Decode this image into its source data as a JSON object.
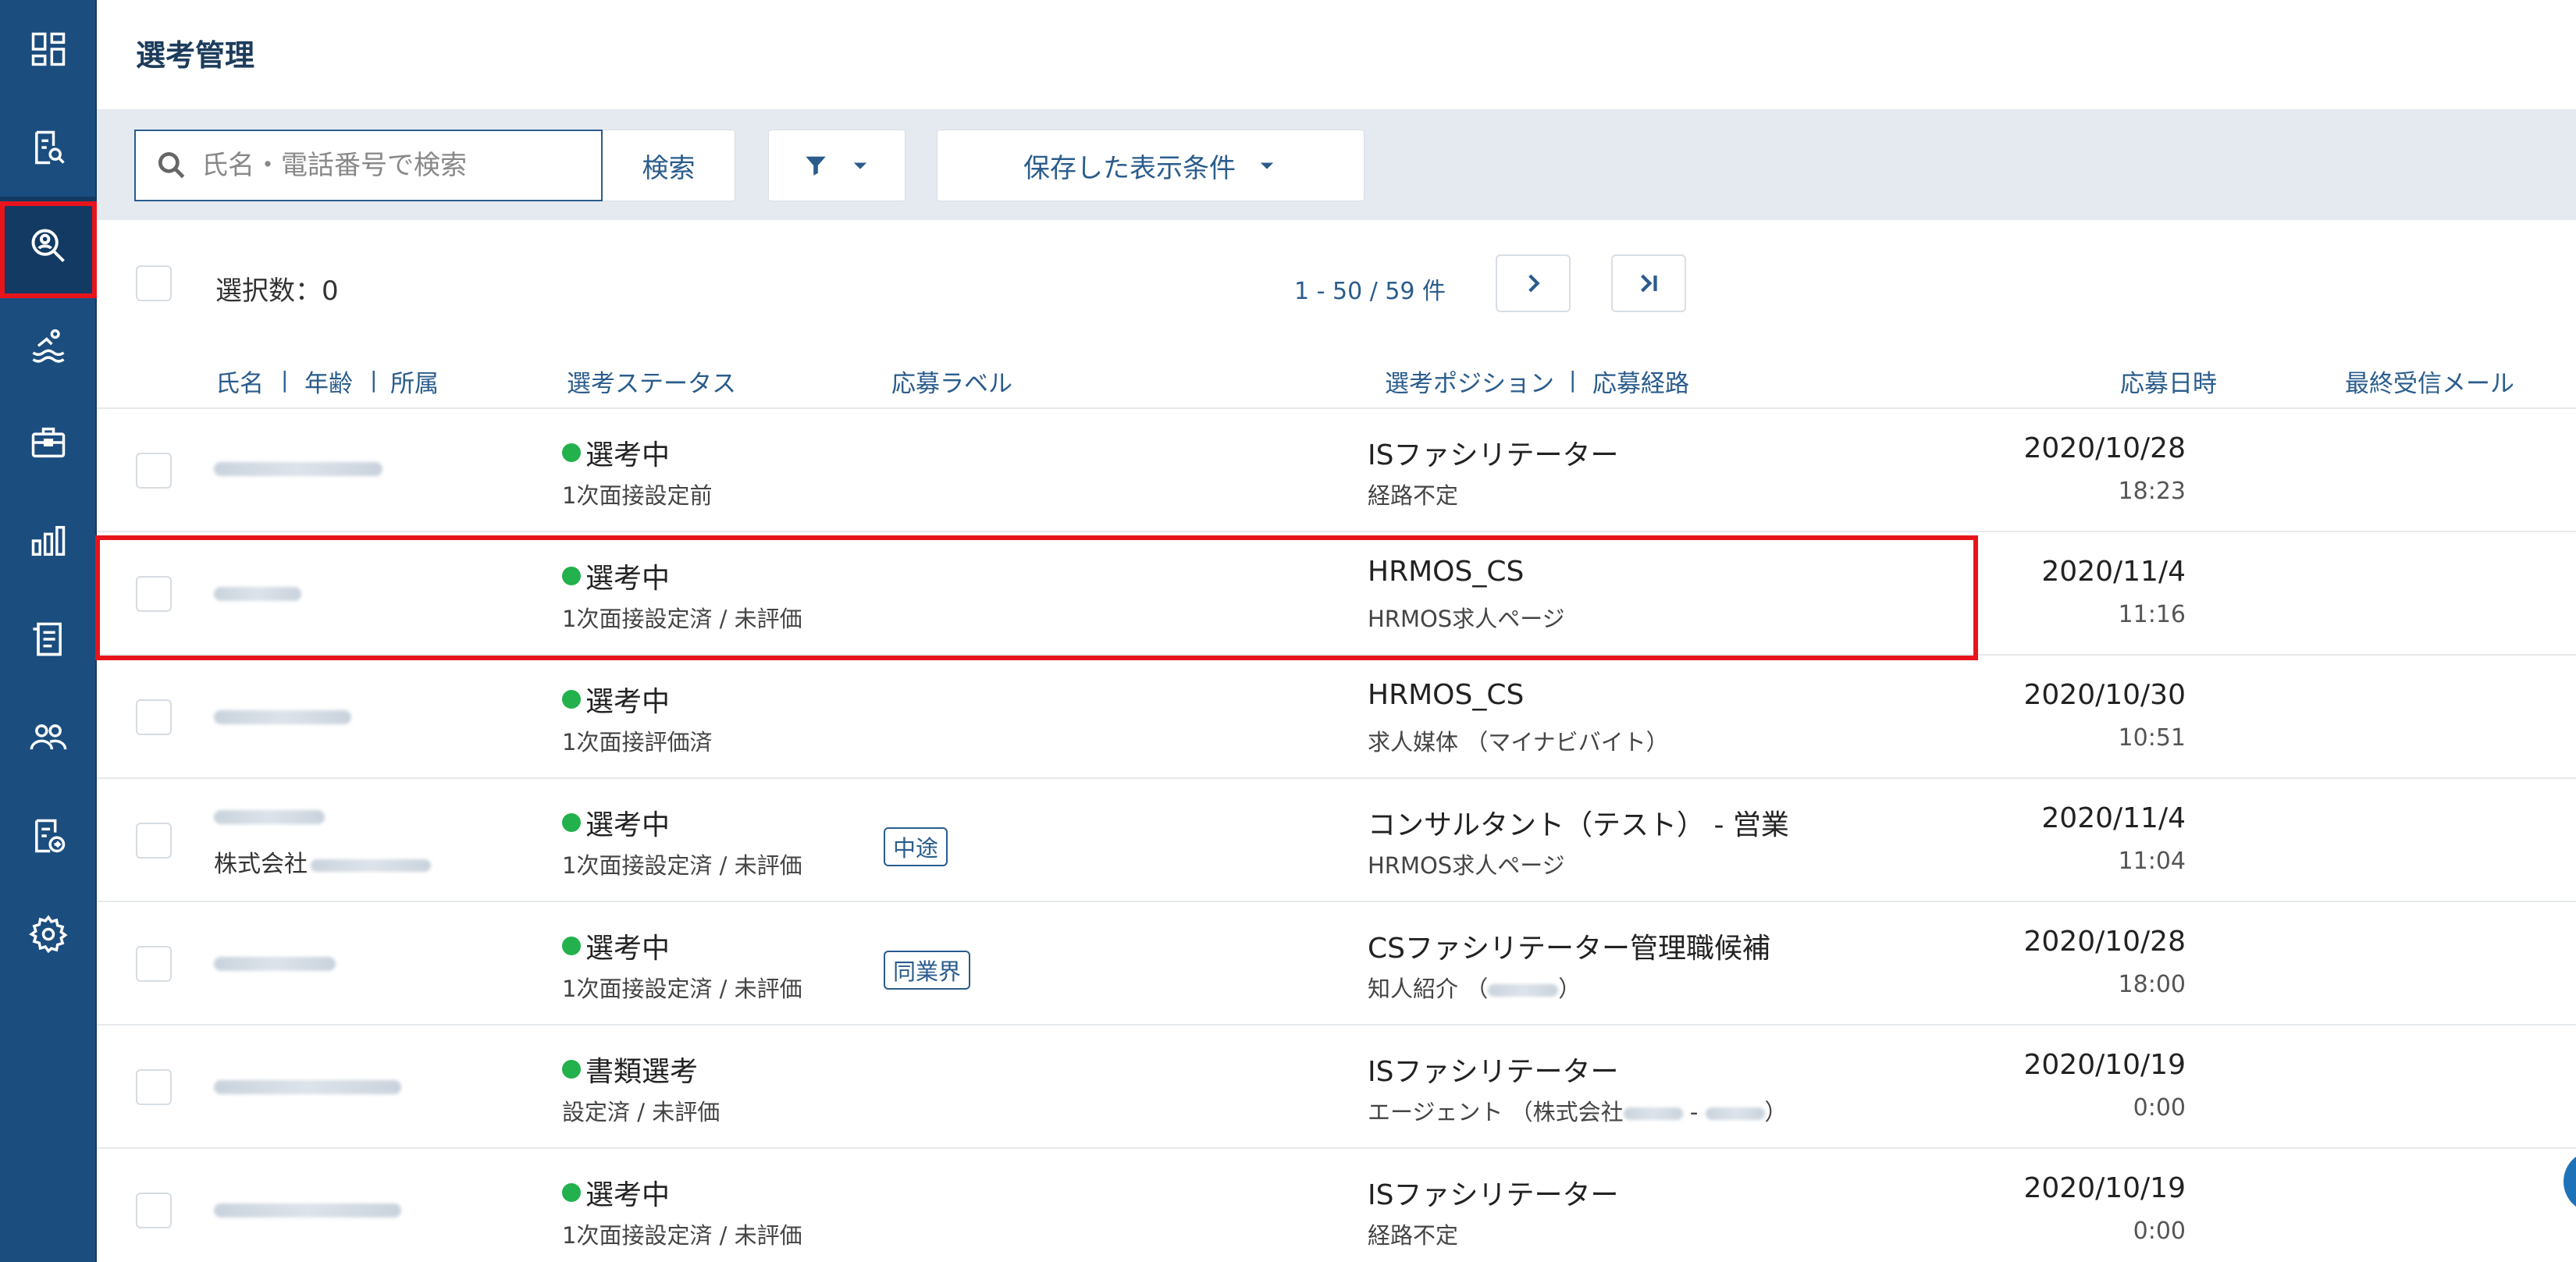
{
  "page_title": "選考管理",
  "search": {
    "placeholder": "氏名・電話番号で検索",
    "button_label": "検索"
  },
  "saved_conditions_label": "保存した表示条件",
  "selection": {
    "count_label": "選択数：0"
  },
  "pagination": {
    "range_label": "1 - 50 / 59 件"
  },
  "columns": {
    "name": "氏名",
    "age": "年齢",
    "affiliation": "所属",
    "status": "選考ステータス",
    "label": "応募ラベル",
    "position": "選考ポジション",
    "route": "応募経路",
    "applied_at": "応募日時",
    "last_mail": "最終受信メール"
  },
  "rows": [
    {
      "status": "選考中",
      "status_detail": "1次面接設定前",
      "position": "ISファシリテーター",
      "route": "経路不定",
      "date": "2020/10/28",
      "time": "18:23"
    },
    {
      "status": "選考中",
      "status_detail": "1次面接設定済 / 未評価",
      "position": "HRMOS_CS",
      "route": "HRMOS求人ページ",
      "date": "2020/11/4",
      "time": "11:16"
    },
    {
      "status": "選考中",
      "status_detail": "1次面接評価済",
      "position": "HRMOS_CS",
      "route": "求人媒体 （マイナビバイト）",
      "date": "2020/10/30",
      "time": "10:51"
    },
    {
      "company_prefix": "株式会社",
      "status": "選考中",
      "status_detail": "1次面接設定済 / 未評価",
      "label": "中途",
      "position": "コンサルタント（テスト） - 営業",
      "route": "HRMOS求人ページ",
      "date": "2020/11/4",
      "time": "11:04"
    },
    {
      "status": "選考中",
      "status_detail": "1次面接設定済 / 未評価",
      "label": "同業界",
      "position": "CSファシリテーター管理職候補",
      "route_prefix": "知人紹介 （",
      "route_suffix": "）",
      "date": "2020/10/28",
      "time": "18:00"
    },
    {
      "status": "書類選考",
      "status_detail": "設定済 / 未評価",
      "position": "ISファシリテーター",
      "route_prefix": "エージェント （株式会社",
      "route_mid": " - ",
      "route_suffix": "）",
      "date": "2020/10/19",
      "time": "0:00"
    },
    {
      "status": "選考中",
      "status_detail": "1次面接設定済 / 未評価",
      "position": "ISファシリテーター",
      "route": "経路不定",
      "date": "2020/10/19",
      "time": "0:00"
    }
  ],
  "sidebar_icons": [
    "dashboard-icon",
    "document-search-icon",
    "candidate-search-icon",
    "swimmer-icon",
    "briefcase-icon",
    "bar-chart-icon",
    "document-list-icon",
    "users-icon",
    "document-export-icon",
    "gear-icon"
  ],
  "colors": {
    "sidebar": "#1b4d7e",
    "accent": "#2a5c8c",
    "highlight": "#e8141c",
    "status_dot": "#22b14c"
  }
}
